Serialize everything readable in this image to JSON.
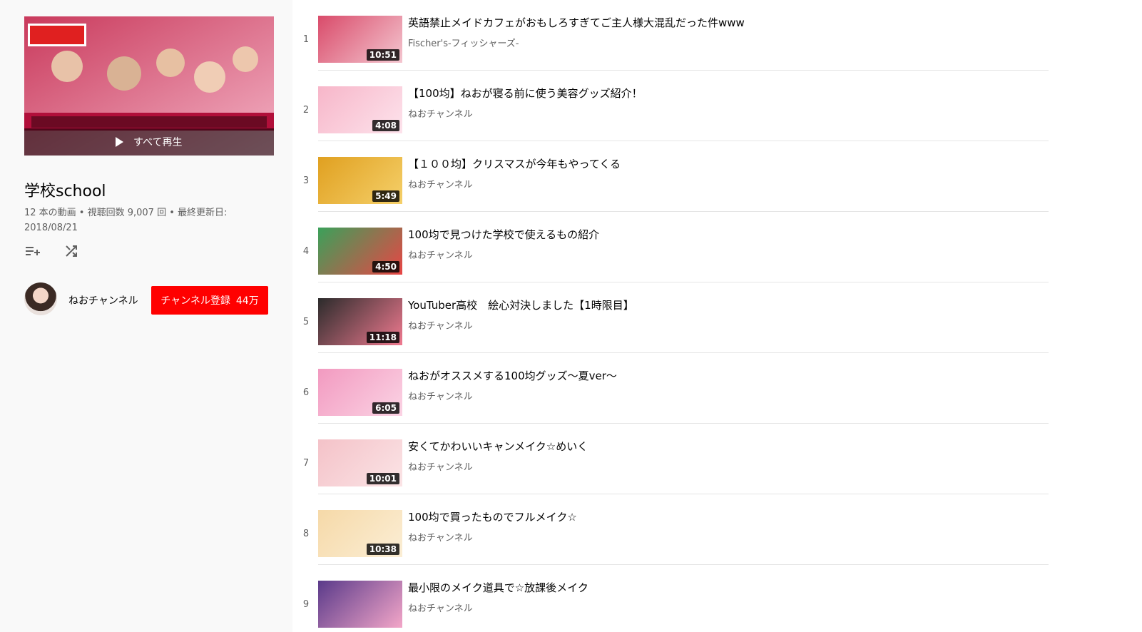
{
  "playlist": {
    "play_all_label": "すべて再生",
    "title": "学校school",
    "stats": "12 本の動画 • 視聴回数 9,007 回 • 最終更新日: 2018/08/21",
    "actions": [
      {
        "icon": "add-to-queue-icon"
      },
      {
        "icon": "shuffle-icon"
      }
    ]
  },
  "owner": {
    "name": "ねおチャンネル",
    "subscribe_label": "チャンネル登録",
    "subscriber_count": "44万"
  },
  "colors": {
    "subscribe_red": "#ff0000",
    "sidebar_bg": "#f9f9f9",
    "secondary_text": "#606060"
  },
  "videos": [
    {
      "index": "1",
      "title": "英語禁止メイドカフェがおもしろすぎてご主人様大混乱だった件www",
      "channel": "Fischer's-フィッシャーズ-",
      "duration": "10:51",
      "thumb_colors": [
        "#d94b6a",
        "#f4c6d0"
      ]
    },
    {
      "index": "2",
      "title": "【100均】ねおが寝る前に使う美容グッズ紹介！",
      "channel": "ねおチャンネル",
      "duration": "4:08",
      "thumb_colors": [
        "#f7b6c9",
        "#fde3ec"
      ]
    },
    {
      "index": "3",
      "title": "【１００均】クリスマスが今年もやってくる",
      "channel": "ねおチャンネル",
      "duration": "5:49",
      "thumb_colors": [
        "#e0a020",
        "#f5d06a"
      ]
    },
    {
      "index": "4",
      "title": "100均で見つけた学校で使えるもの紹介",
      "channel": "ねおチャンネル",
      "duration": "4:50",
      "thumb_colors": [
        "#3aa15a",
        "#e94545"
      ]
    },
    {
      "index": "5",
      "title": "YouTuber高校　絵心対決しました【1時限目】",
      "channel": "ねおチャンネル",
      "duration": "11:18",
      "thumb_colors": [
        "#2b2b2b",
        "#f07a90"
      ]
    },
    {
      "index": "6",
      "title": "ねおがオススメする100均グッズ〜夏ver〜",
      "channel": "ねおチャンネル",
      "duration": "6:05",
      "thumb_colors": [
        "#f29ac0",
        "#fbd3e4"
      ]
    },
    {
      "index": "7",
      "title": "安くてかわいいキャンメイク☆めいく",
      "channel": "ねおチャンネル",
      "duration": "10:01",
      "thumb_colors": [
        "#f4c2c8",
        "#fbe4e6"
      ]
    },
    {
      "index": "8",
      "title": "100均で買ったものでフルメイク☆",
      "channel": "ねおチャンネル",
      "duration": "10:38",
      "thumb_colors": [
        "#f6d9a8",
        "#fbeed5"
      ]
    },
    {
      "index": "9",
      "title": "最小限のメイク道具で☆放課後メイク",
      "channel": "ねおチャンネル",
      "duration": "",
      "thumb_colors": [
        "#5a3a8a",
        "#f3a6c8"
      ]
    }
  ]
}
